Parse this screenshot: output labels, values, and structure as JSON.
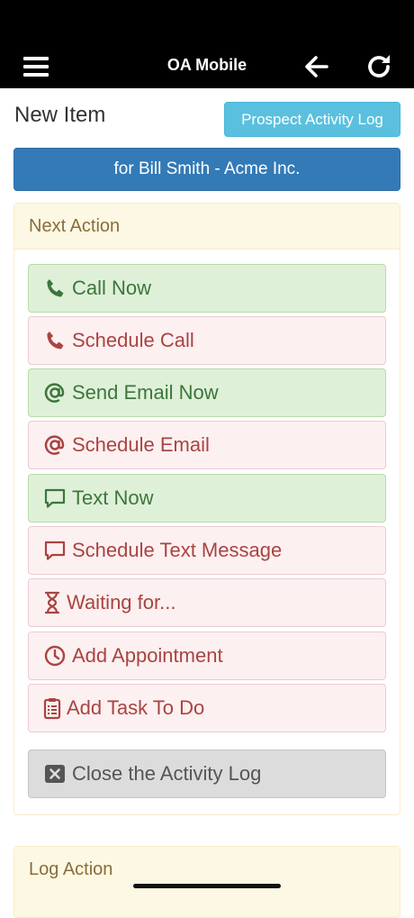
{
  "header": {
    "title": "OA Mobile"
  },
  "page": {
    "title": "New Item",
    "log_button": "Prospect Activity Log",
    "for_button": "for Bill Smith - Acme Inc."
  },
  "next_action": {
    "heading": "Next Action",
    "items": [
      {
        "label": "Call Now",
        "icon": "phone-icon",
        "style": "success"
      },
      {
        "label": "Schedule Call",
        "icon": "phone-icon",
        "style": "danger"
      },
      {
        "label": "Send Email Now",
        "icon": "at-icon",
        "style": "success"
      },
      {
        "label": "Schedule Email",
        "icon": "at-icon",
        "style": "danger"
      },
      {
        "label": "Text Now",
        "icon": "chat-bubble-icon",
        "style": "success"
      },
      {
        "label": "Schedule Text Message",
        "icon": "chat-bubble-icon",
        "style": "danger"
      },
      {
        "label": "Waiting for...",
        "icon": "hourglass-icon",
        "style": "danger"
      },
      {
        "label": "Add Appointment",
        "icon": "clock-icon",
        "style": "danger"
      },
      {
        "label": "Add Task To Do",
        "icon": "clipboard-icon",
        "style": "danger"
      }
    ],
    "close": {
      "label": "Close the Activity Log",
      "icon": "close-box-icon"
    }
  },
  "log_action": {
    "heading": "Log Action"
  },
  "colors": {
    "success_text": "#3c763d",
    "danger_text": "#a94442",
    "info_button": "#5bc0de",
    "primary_button": "#337ab7",
    "warning_heading": "#fcf8e3"
  }
}
